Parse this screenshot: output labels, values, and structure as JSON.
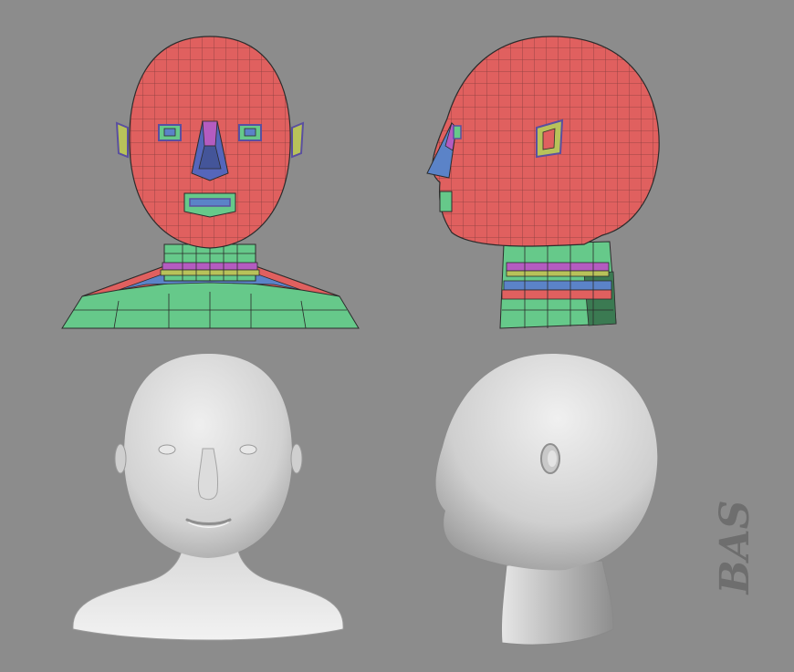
{
  "signature": {
    "text": "BAS",
    "color": "#6a6a6a"
  },
  "colors": {
    "background": "#8c8c8c",
    "head_red": "#e0605f",
    "neck_green": "#66c98a",
    "ring_purple": "#b45cc0",
    "ring_blue": "#5b83c8",
    "ring_yellow": "#b8c25a",
    "nose_blue": "#5566bb",
    "wire": "#2b2b2b",
    "clay": "#d9d9d9"
  },
  "views": [
    {
      "name": "wireframe-front",
      "style": "colored-mesh"
    },
    {
      "name": "wireframe-side",
      "style": "colored-mesh"
    },
    {
      "name": "sculpt-front",
      "style": "smooth-clay"
    },
    {
      "name": "sculpt-side",
      "style": "smooth-clay"
    }
  ]
}
